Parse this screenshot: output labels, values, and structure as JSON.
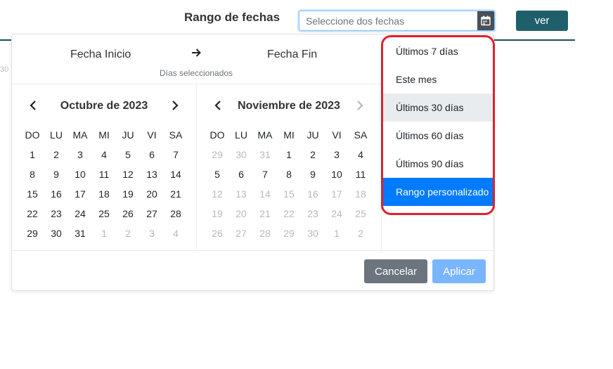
{
  "header": {
    "label": "Rango de fechas",
    "placeholder": "Seleccione dos fechas",
    "view_button": "ver",
    "calendar_icon": "calendar-icon"
  },
  "ghost_text": "30",
  "picker": {
    "start_label": "Fecha Inicio",
    "end_label": "Fecha Fin",
    "selected_days_label": "Días seleccionados",
    "weekdays": [
      "DO",
      "LU",
      "MA",
      "MI",
      "JU",
      "VI",
      "SA"
    ],
    "months": [
      {
        "title": "Octubre de 2023",
        "days": [
          {
            "d": "1",
            "m": false
          },
          {
            "d": "2",
            "m": false
          },
          {
            "d": "3",
            "m": false
          },
          {
            "d": "4",
            "m": false
          },
          {
            "d": "5",
            "m": false
          },
          {
            "d": "6",
            "m": false
          },
          {
            "d": "7",
            "m": false
          },
          {
            "d": "8",
            "m": false
          },
          {
            "d": "9",
            "m": false
          },
          {
            "d": "10",
            "m": false
          },
          {
            "d": "11",
            "m": false
          },
          {
            "d": "12",
            "m": false
          },
          {
            "d": "13",
            "m": false
          },
          {
            "d": "14",
            "m": false
          },
          {
            "d": "15",
            "m": false
          },
          {
            "d": "16",
            "m": false
          },
          {
            "d": "17",
            "m": false
          },
          {
            "d": "18",
            "m": false
          },
          {
            "d": "19",
            "m": false
          },
          {
            "d": "20",
            "m": false
          },
          {
            "d": "21",
            "m": false
          },
          {
            "d": "22",
            "m": false
          },
          {
            "d": "23",
            "m": false
          },
          {
            "d": "24",
            "m": false
          },
          {
            "d": "25",
            "m": false
          },
          {
            "d": "26",
            "m": false
          },
          {
            "d": "27",
            "m": false
          },
          {
            "d": "28",
            "m": false
          },
          {
            "d": "29",
            "m": false
          },
          {
            "d": "30",
            "m": false
          },
          {
            "d": "31",
            "m": false
          },
          {
            "d": "1",
            "m": true
          },
          {
            "d": "2",
            "m": true
          },
          {
            "d": "3",
            "m": true
          },
          {
            "d": "4",
            "m": true
          }
        ]
      },
      {
        "title": "Noviembre de 2023",
        "days": [
          {
            "d": "29",
            "m": true
          },
          {
            "d": "30",
            "m": true
          },
          {
            "d": "31",
            "m": true
          },
          {
            "d": "1",
            "m": false
          },
          {
            "d": "2",
            "m": false
          },
          {
            "d": "3",
            "m": false
          },
          {
            "d": "4",
            "m": false
          },
          {
            "d": "5",
            "m": false
          },
          {
            "d": "6",
            "m": false
          },
          {
            "d": "7",
            "m": false
          },
          {
            "d": "8",
            "m": false
          },
          {
            "d": "9",
            "m": false
          },
          {
            "d": "10",
            "m": false
          },
          {
            "d": "11",
            "m": false
          },
          {
            "d": "12",
            "m": true
          },
          {
            "d": "13",
            "m": true
          },
          {
            "d": "14",
            "m": true
          },
          {
            "d": "15",
            "m": true
          },
          {
            "d": "16",
            "m": true
          },
          {
            "d": "17",
            "m": true
          },
          {
            "d": "18",
            "m": true
          },
          {
            "d": "19",
            "m": true
          },
          {
            "d": "20",
            "m": true
          },
          {
            "d": "21",
            "m": true
          },
          {
            "d": "22",
            "m": true
          },
          {
            "d": "23",
            "m": true
          },
          {
            "d": "24",
            "m": true
          },
          {
            "d": "25",
            "m": true
          },
          {
            "d": "26",
            "m": true
          },
          {
            "d": "27",
            "m": true
          },
          {
            "d": "28",
            "m": true
          },
          {
            "d": "29",
            "m": true
          },
          {
            "d": "30",
            "m": true
          },
          {
            "d": "1",
            "m": true
          },
          {
            "d": "2",
            "m": true
          }
        ]
      }
    ],
    "cancel_label": "Cancelar",
    "apply_label": "Aplicar"
  },
  "ranges": {
    "items": [
      "Últimos 7 días",
      "Este mes",
      "Últimos 30 días",
      "Últimos 60 días",
      "Últimos 90 días",
      "Rango personalizado"
    ],
    "hover_index": 2,
    "active_index": 5,
    "highlight_color": "#e3202a"
  },
  "colors": {
    "primary": "#007bff",
    "teal": "#1f5f6b",
    "secondary": "#6c757d"
  }
}
